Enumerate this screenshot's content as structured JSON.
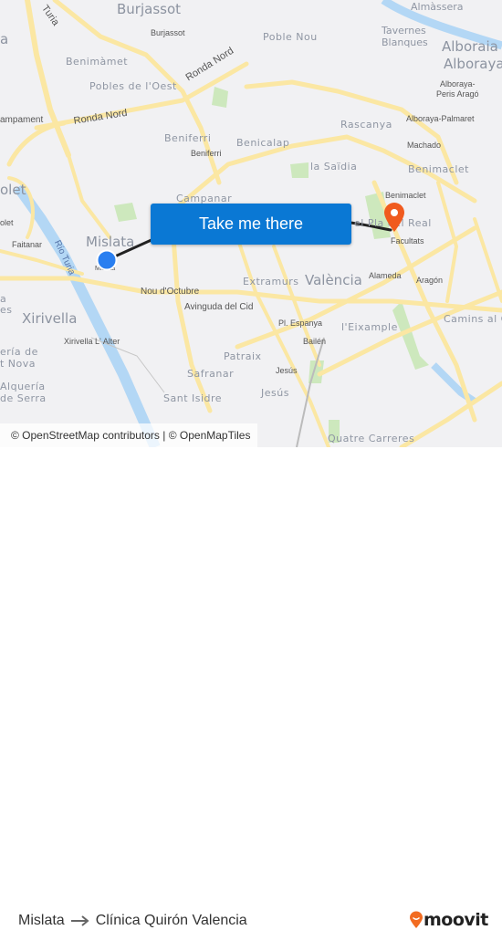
{
  "map": {
    "places": {
      "burjassot": "Burjassot",
      "burjassot_stop": "Burjassot",
      "benimamet": "Benimàmet",
      "pobles_oest": "Pobles de l'Oest",
      "poble_nou": "Poble Nou",
      "tavernes": "Tavernes",
      "blanques": "Blanques",
      "alboraia": "Alboraia /",
      "alboraya": "Alboraya",
      "alboraya_peris_1": "Alboraya-",
      "alboraya_peris_2": "Peris Aragó",
      "alboraya_palmaret": "Alboraya-Palmaret",
      "rascanya": "Rascanya",
      "machado": "Machado",
      "benimaclet": "Benimaclet",
      "benimaclet_stop": "Benimaclet",
      "beniferri": "Beniferri",
      "beniferri_stop": "Beniferri",
      "benicalap": "Benicalap",
      "la_saidia": "la Saïdia",
      "campanar": "Campanar",
      "campament": "ampament",
      "olet": "olet",
      "olet_stop": "olet",
      "faitanar": "Faitanar",
      "mislata": "Mislata",
      "mislata_stop": "Mislata",
      "pla_reial": "el Pla del Real",
      "facultats": "Facultats",
      "extramurs": "Extramurs",
      "valencia": "València",
      "alameda": "Alameda",
      "aragon": "Aragón",
      "camins": "Camins al Gr",
      "xirivella": "Xirivella",
      "xirivella_alter": "Xirivella L' Alter",
      "pl_espanya": "Pl. Espanya",
      "eixample": "l'Eixample",
      "bailen": "Bailén",
      "patraix": "Patraix",
      "safranar": "Safranar",
      "jesus_stop": "Jesús",
      "jesus": "Jesús",
      "sant_isidre": "Sant Isidre",
      "quatre_carreres": "Quatre Carreres",
      "alqueria_1": "Alquería",
      "alqueria_2": "de Serra",
      "eria_1": "ería de",
      "eria_2": "t Nova",
      "a_es_1": "a",
      "a_es_2": "es",
      "almassera": "Almàssera",
      "a_left": "a"
    },
    "roads": {
      "turia": "Turia",
      "ronda_nord_1": "Ronda Nord",
      "ronda_nord_2": "Ronda Nord",
      "rio_turia": "Río Turia",
      "nou_octubre": "Nou d'Octubre",
      "avinguda_cid": "Avinguda del Cid"
    },
    "cta_label": "Take me there",
    "attribution": "© OpenStreetMap contributors | © OpenMapTiles",
    "colors": {
      "cta": "#0a78d4",
      "origin": "#2a7ff0",
      "destination": "#f05a1e",
      "road": "#fbe7a3",
      "water": "#b3d7f5",
      "park": "#c8e6b5"
    },
    "origin_icon": "origin-dot-icon",
    "destination_icon": "destination-pin-icon"
  },
  "footer": {
    "origin": "Mislata",
    "arrow_icon": "arrow-right-icon",
    "destination": "Clínica Quirón Valencia",
    "logo_text": "moovit"
  }
}
